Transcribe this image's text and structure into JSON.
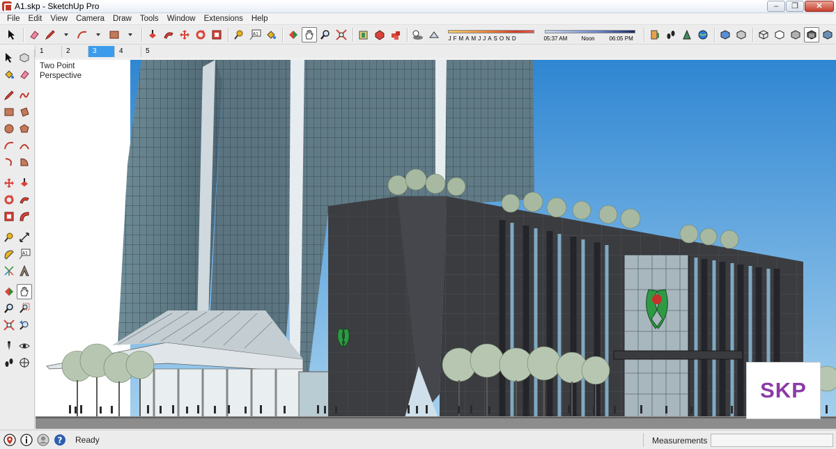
{
  "window": {
    "title": "A1.skp - SketchUp Pro",
    "controls": {
      "minimize": "–",
      "maximize": "❐",
      "close": "✕"
    }
  },
  "menu": {
    "items": [
      {
        "label": "File"
      },
      {
        "label": "Edit"
      },
      {
        "label": "View"
      },
      {
        "label": "Camera"
      },
      {
        "label": "Draw"
      },
      {
        "label": "Tools"
      },
      {
        "label": "Window"
      },
      {
        "label": "Extensions"
      },
      {
        "label": "Help"
      }
    ]
  },
  "shadows": {
    "months": [
      "J",
      "F",
      "M",
      "A",
      "M",
      "J",
      "J",
      "A",
      "S",
      "O",
      "N",
      "D"
    ],
    "time_start": "05:37 AM",
    "time_mid": "Noon",
    "time_end": "06:05 PM"
  },
  "scenes": {
    "tabs": [
      {
        "label": "1"
      },
      {
        "label": "2"
      },
      {
        "label": "3"
      },
      {
        "label": "4"
      },
      {
        "label": "5"
      }
    ],
    "active_index": 2
  },
  "viewport": {
    "camera_line1": "Two Point",
    "camera_line2": "Perspective",
    "watermark": "SKP"
  },
  "statusbar": {
    "status": "Ready",
    "measurements_label": "Measurements",
    "measurements_value": ""
  },
  "colors": {
    "active_tab": "#3c9cec",
    "watermark": "#8b3aa8",
    "sky": "#3f8fd6",
    "tower_glass": "#5f7a86",
    "facade": "#3d3e42"
  }
}
